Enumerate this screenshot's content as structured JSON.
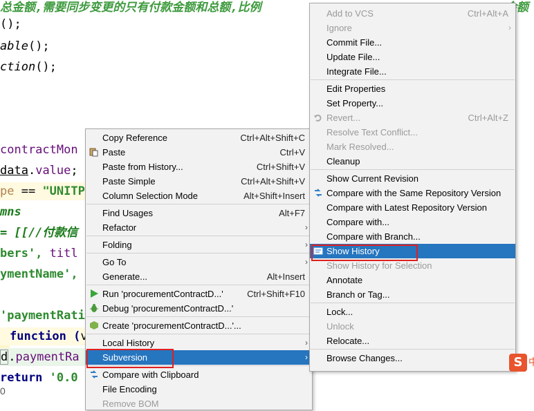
{
  "editor": {
    "lines": [
      {
        "t1": "总金额,需要同步变更的只有付款金额和总额,比例",
        "t2": "金额"
      },
      {
        "t1": "();"
      },
      {
        "t1": "able",
        "t2": "();"
      },
      {
        "t1": "ction",
        "t2": "();"
      },
      {
        "t1": "contractMon"
      },
      {
        "t1": "data",
        "t2": ".",
        "t3": "value",
        "t4": ";"
      },
      {
        "t1": "pe",
        "t2": " == ",
        "t3": "\"UNITP"
      },
      {
        "t1": "mns"
      },
      {
        "t1": "= [[//付款信"
      },
      {
        "t1": "bers', ",
        "t2": "titl"
      },
      {
        "t1": "ymentName',"
      },
      {
        "t1": "'paymentRati"
      },
      {
        "t1": "function (",
        "t2": "v"
      },
      {
        "t1": "d",
        "t2": ".",
        "t3": "paymentRa"
      },
      {
        "t1": "return ",
        "t2": "'0.0"
      }
    ],
    "status_text": "0"
  },
  "context_menu": {
    "items": [
      {
        "label": "Copy Reference",
        "shortcut": "Ctrl+Alt+Shift+C"
      },
      {
        "label": "Paste",
        "shortcut": "Ctrl+V",
        "icon": "paste-icon"
      },
      {
        "label": "Paste from History...",
        "shortcut": "Ctrl+Shift+V"
      },
      {
        "label": "Paste Simple",
        "shortcut": "Ctrl+Alt+Shift+V"
      },
      {
        "label": "Column Selection Mode",
        "shortcut": "Alt+Shift+Insert"
      },
      {
        "label": "Find Usages",
        "shortcut": "Alt+F7"
      },
      {
        "label": "Refactor",
        "submenu": true
      },
      {
        "label": "Folding",
        "submenu": true
      },
      {
        "label": "Go To",
        "submenu": true
      },
      {
        "label": "Generate...",
        "shortcut": "Alt+Insert"
      },
      {
        "label": "Run 'procurementContractD...'",
        "shortcut": "Ctrl+Shift+F10",
        "icon": "run-icon"
      },
      {
        "label": "Debug 'procurementContractD...'",
        "icon": "debug-icon"
      },
      {
        "label": "Create 'procurementContractD...'...",
        "icon": "nodejs-icon"
      },
      {
        "label": "Local History",
        "submenu": true
      },
      {
        "label": "Subversion",
        "submenu": true,
        "selected": true
      },
      {
        "label": "Compare with Clipboard",
        "icon": "compare-icon"
      },
      {
        "label": "File Encoding"
      },
      {
        "label": "Remove BOM",
        "disabled": true
      }
    ]
  },
  "subversion_menu": {
    "items": [
      {
        "label": "Add to VCS",
        "shortcut": "Ctrl+Alt+A",
        "disabled": true
      },
      {
        "label": "Ignore",
        "submenu": true,
        "disabled": true
      },
      {
        "label": "Commit File..."
      },
      {
        "label": "Update File..."
      },
      {
        "label": "Integrate File..."
      },
      {
        "label": "Edit Properties"
      },
      {
        "label": "Set Property..."
      },
      {
        "label": "Revert...",
        "shortcut": "Ctrl+Alt+Z",
        "disabled": true,
        "icon": "revert-icon"
      },
      {
        "label": "Resolve Text Conflict...",
        "disabled": true
      },
      {
        "label": "Mark Resolved...",
        "disabled": true
      },
      {
        "label": "Cleanup"
      },
      {
        "label": "Show Current Revision"
      },
      {
        "label": "Compare with the Same Repository Version",
        "icon": "compare-icon"
      },
      {
        "label": "Compare with Latest Repository Version"
      },
      {
        "label": "Compare with..."
      },
      {
        "label": "Compare with Branch..."
      },
      {
        "label": "Show History",
        "selected": true,
        "icon": "history-icon"
      },
      {
        "label": "Show History for Selection",
        "disabled": true
      },
      {
        "label": "Annotate"
      },
      {
        "label": "Branch or Tag..."
      },
      {
        "label": "Lock..."
      },
      {
        "label": "Unlock",
        "disabled": true
      },
      {
        "label": "Relocate..."
      },
      {
        "label": "Browse Changes..."
      }
    ]
  },
  "ime": {
    "logo": "S",
    "extra": "中"
  },
  "colors": {
    "selection": "#2675bf",
    "highlight_box": "#e02020",
    "menu_bg": "#f2f2f2"
  }
}
